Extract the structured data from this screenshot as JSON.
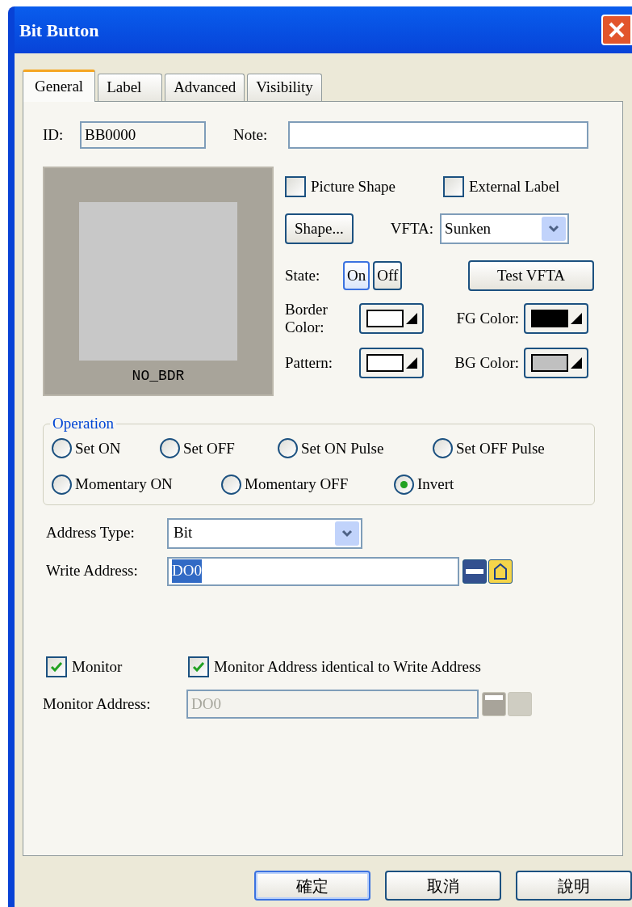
{
  "window": {
    "title": "Bit Button"
  },
  "tabs": [
    {
      "label": "General",
      "selected": true
    },
    {
      "label": "Label",
      "selected": false
    },
    {
      "label": "Advanced",
      "selected": false
    },
    {
      "label": "Visibility",
      "selected": false
    }
  ],
  "id_field": {
    "label": "ID:",
    "value": "BB0000"
  },
  "note_field": {
    "label": "Note:"
  },
  "preview": {
    "caption": "NO_BDR"
  },
  "checkboxes": [
    {
      "label": "Picture Shape",
      "checked": false
    },
    {
      "label": "External Label",
      "checked": false
    }
  ],
  "shape_button": "Shape...",
  "vfta": {
    "label": "VFTA:",
    "value": "Sunken"
  },
  "state": {
    "label": "State:",
    "options": [
      {
        "label": "On",
        "selected": true
      },
      {
        "label": "Off",
        "selected": false
      }
    ]
  },
  "test_button": "Test VFTA",
  "colors": [
    {
      "label": "Border Color:",
      "color": "#ffffff"
    },
    {
      "label": "FG Color:",
      "color": "#000000"
    },
    {
      "label": "Pattern:",
      "color": "#ffffff"
    },
    {
      "label": "BG Color:",
      "color": "#c0c0c0"
    }
  ],
  "operation": {
    "title": "Operation",
    "rows": [
      {
        "options": [
          {
            "label": "Set ON",
            "selected": false
          },
          {
            "label": "Set OFF",
            "selected": false
          },
          {
            "label": "Set ON Pulse",
            "selected": false
          },
          {
            "label": "Set OFF Pulse",
            "selected": false
          }
        ]
      },
      {
        "options": [
          {
            "label": "Momentary ON",
            "selected": false
          },
          {
            "label": "Momentary OFF",
            "selected": false
          },
          {
            "label": "Invert",
            "selected": true
          }
        ]
      }
    ]
  },
  "address_type": {
    "label": "Address Type:",
    "value": "Bit"
  },
  "write_address": {
    "label": "Write Address:",
    "value": "DO0",
    "disabled": false
  },
  "monitor_checks": [
    {
      "label": "Monitor",
      "checked": true
    },
    {
      "label": "Monitor Address identical to Write Address",
      "checked": true
    }
  ],
  "monitor_address": {
    "label": "Monitor Address:",
    "value": "DO0",
    "disabled": true
  },
  "buttons": [
    {
      "label": "確定",
      "default": true
    },
    {
      "label": "取消",
      "default": false
    },
    {
      "label": "說明",
      "default": false
    }
  ]
}
